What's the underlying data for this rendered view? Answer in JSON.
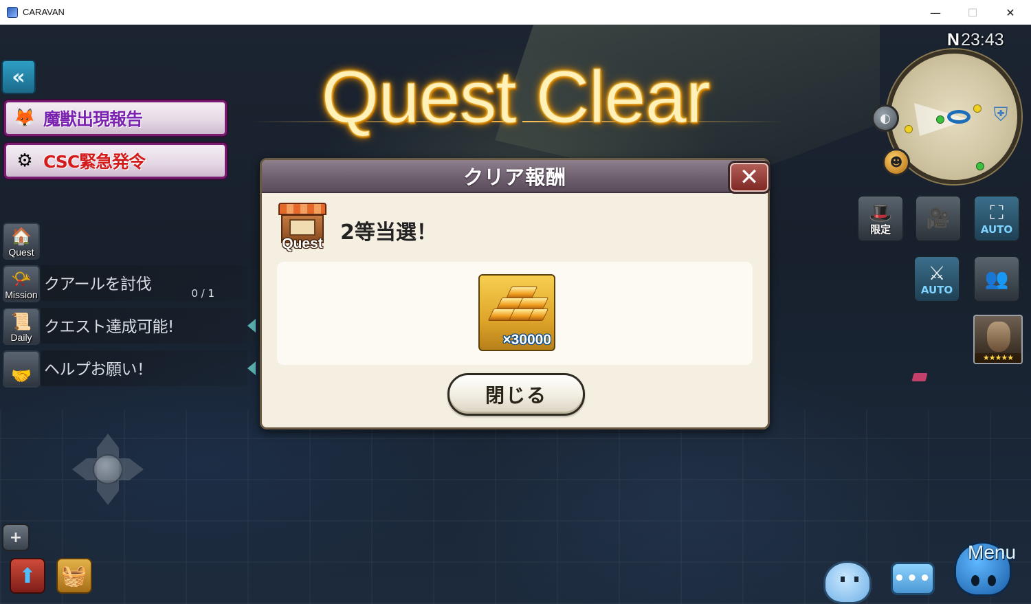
{
  "window": {
    "title": "CARAVAN",
    "minimize": "—",
    "maximize": "☐",
    "close": "✕"
  },
  "hud": {
    "title": "Quest Clear",
    "clock": {
      "compass": "N",
      "time": "23:43"
    },
    "banners": [
      {
        "label": "魔獣出現報告",
        "icon": "fox-mask-icon"
      },
      {
        "label": "CSC緊急発令",
        "icon": "csc-emblem-icon"
      }
    ],
    "tasks": [
      {
        "icon_label": "Quest",
        "label": "",
        "count": ""
      },
      {
        "icon_label": "Mission",
        "label": "クアールを討伐",
        "count": "0 / 1"
      },
      {
        "icon_label": "Daily",
        "label": "クエスト達成可能!",
        "count": ""
      },
      {
        "icon_label": "",
        "label": "ヘルプお願い！",
        "count": ""
      }
    ],
    "right_buttons": [
      {
        "name": "limited",
        "label": "限定"
      },
      {
        "name": "camera",
        "label": ""
      },
      {
        "name": "auto-1",
        "label": "AUTO"
      },
      {
        "name": "auto-2",
        "label": "AUTO"
      },
      {
        "name": "party",
        "label": ""
      }
    ],
    "portrait_stars": "★★★★★",
    "chat_bubble": "•••",
    "menu_label": "Menu"
  },
  "dialog": {
    "title": "クリア報酬",
    "badge_label": "Quest",
    "prize_text": "2等当選！",
    "reward": {
      "item": "gold-ingots",
      "quantity": "×30000"
    },
    "close_label": "閉じる"
  },
  "colors": {
    "title_glow": "#f5a500",
    "dialog_bg": "#f4efe0",
    "dialog_header": "#6f6070",
    "banner_border": "#7a1b72"
  }
}
